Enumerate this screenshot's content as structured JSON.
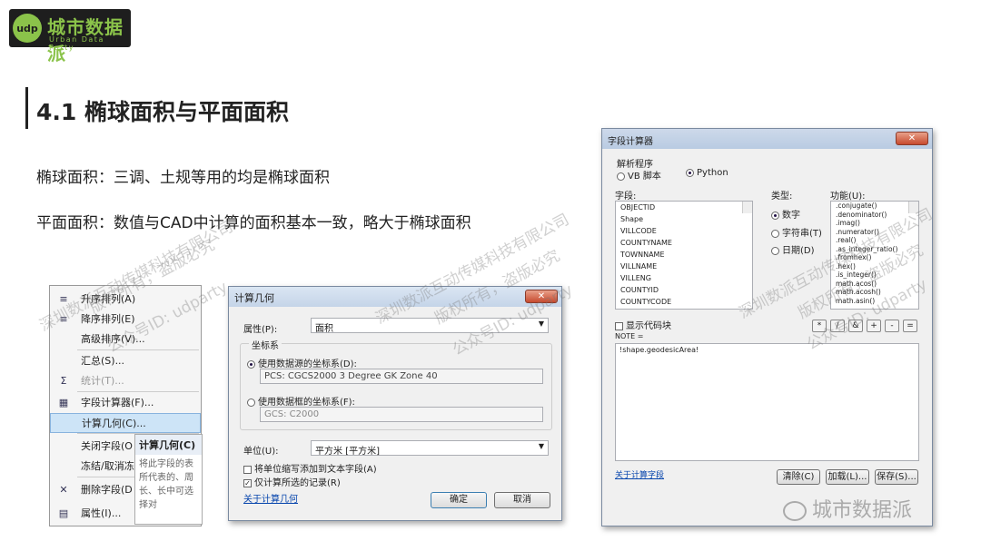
{
  "logo": {
    "mark": "udp",
    "name": "城市数据派",
    "sub": "Urban Data Party"
  },
  "slide": {
    "title": "4.1 椭球面积与平面面积",
    "line1": "椭球面积：三调、土规等用的均是椭球面积",
    "line2": "平面面积：数值与CAD中计算的面积基本一致，略大于椭球面积"
  },
  "context_menu": {
    "items": [
      {
        "label": "升序排列(A)",
        "icon": "sort-ascending-icon",
        "disabled": false
      },
      {
        "label": "降序排列(E)",
        "icon": "sort-descending-icon",
        "disabled": false
      },
      {
        "label": "高级排序(V)...",
        "icon": "",
        "disabled": false
      },
      {
        "label": "汇总(S)...",
        "icon": "",
        "disabled": false
      },
      {
        "label": "统计(T)...",
        "icon": "sigma-icon",
        "disabled": true
      },
      {
        "label": "字段计算器(F)...",
        "icon": "calculator-icon",
        "disabled": false
      },
      {
        "label": "计算几何(C)...",
        "icon": "",
        "disabled": false,
        "selected": true
      },
      {
        "label": "关闭字段(O",
        "icon": "",
        "disabled": false
      },
      {
        "label": "冻结/取消冻",
        "icon": "",
        "disabled": false
      },
      {
        "label": "删除字段(D",
        "icon": "delete-icon",
        "disabled": false
      },
      {
        "label": "属性(I)...",
        "icon": "properties-icon",
        "disabled": false
      }
    ],
    "tooltip": {
      "title": "计算几何(C)",
      "body": "将此字段的表所代表的、周长、长中可选择对"
    }
  },
  "calc_geom": {
    "title": "计算几何",
    "close": "✕",
    "property_label": "属性(P):",
    "property_value": "面积",
    "coord_group": "坐标系",
    "use_source": "使用数据源的坐标系(D):",
    "source_value": "PCS: CGCS2000 3 Degree GK Zone 40",
    "use_frame": "使用数据框的坐标系(F):",
    "frame_value": "GCS: C2000",
    "unit_label": "单位(U):",
    "unit_value": "平方米 [平方米]",
    "add_unit": "将单位缩写添加到文本字段(A)",
    "only_selected": "仅计算所选的记录(R)",
    "about": "关于计算几何",
    "ok": "确定",
    "cancel": "取消"
  },
  "field_calc": {
    "title": "字段计算器",
    "close": "✕",
    "parser_label": "解析程序",
    "parser_vb": "VB 脚本",
    "parser_python": "Python",
    "fields_label": "字段:",
    "fields": [
      "OBJECTID",
      "Shape",
      "VILLCODE",
      "COUNTYNAME",
      "TOWNNAME",
      "VILLNAME",
      "VILLENG",
      "COUNTYID",
      "COUNTYCODE"
    ],
    "type_label": "类型:",
    "type_number": "数字",
    "type_string": "字符串(T)",
    "type_date": "日期(D)",
    "func_label": "功能(U):",
    "functions": [
      ".conjugate()",
      ".denominator()",
      ".imag()",
      ".numerator()",
      ".real()",
      ".as_integer_ratio()",
      ".fromhex()",
      ".hex()",
      ".is_integer()",
      "math.acos()",
      "math.acosh()",
      "math.asin()"
    ],
    "show_codeblock": "显示代码块",
    "note": "NOTE =",
    "expression": "!shape.geodesicArea!",
    "ops": [
      "*",
      "/",
      "&",
      "+",
      "-",
      "="
    ],
    "about": "关于计算字段",
    "clear": "清除(C)",
    "load": "加载(L)...",
    "save": "保存(S)..."
  },
  "watermarks": [
    "深圳数派互动传媒科技有限公司",
    "版权所有，盗版必究",
    "公众号ID: udparty"
  ],
  "footer": {
    "label": "城市数据派"
  }
}
